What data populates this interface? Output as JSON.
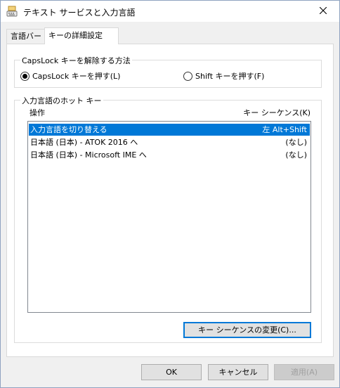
{
  "window": {
    "title": "テキスト サービスと入力言語"
  },
  "tabs": [
    {
      "label": "言語バー",
      "active": false
    },
    {
      "label": "キーの詳細設定",
      "active": true
    }
  ],
  "capslock_group": {
    "label": "CapsLock キーを解除する方法",
    "options": [
      {
        "label": "CapsLock キーを押す(L)",
        "checked": true
      },
      {
        "label": "Shift キーを押す(F)",
        "checked": false
      }
    ]
  },
  "hotkey_group": {
    "label": "入力言語のホット キー",
    "column_action": "操作",
    "column_key": "キー シーケンス(K)",
    "rows": [
      {
        "action": "入力言語を切り替える",
        "keys": "左 Alt+Shift",
        "selected": true
      },
      {
        "action": "日本語 (日本) - ATOK 2016 へ",
        "keys": "(なし)",
        "selected": false
      },
      {
        "action": "日本語 (日本) - Microsoft IME へ",
        "keys": "(なし)",
        "selected": false
      }
    ],
    "change_button": "キー シーケンスの変更(C)..."
  },
  "buttons": {
    "ok": "OK",
    "cancel": "キャンセル",
    "apply": "適用(A)"
  },
  "colors": {
    "selection": "#0078d7",
    "focus": "#0078d7"
  },
  "icons": {
    "app": "keyboard-icon",
    "close": "close-icon"
  }
}
